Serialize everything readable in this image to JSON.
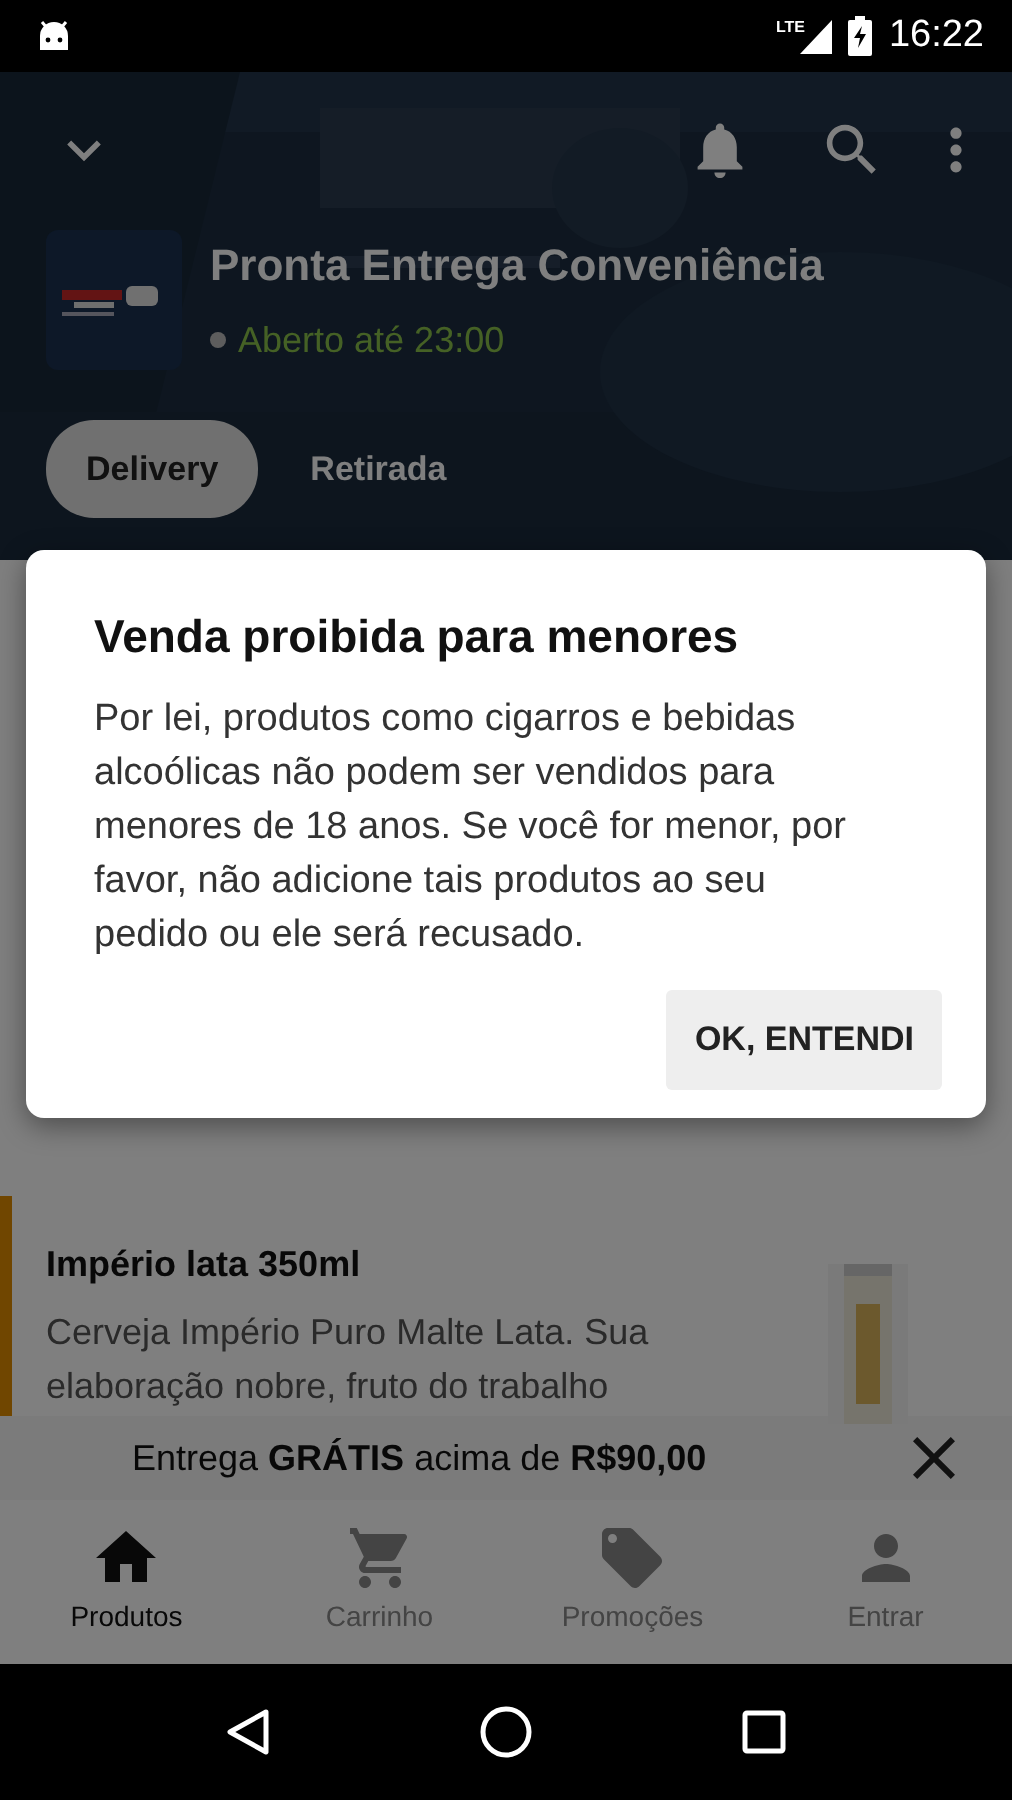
{
  "status_bar": {
    "network": "LTE",
    "time": "16:22"
  },
  "header": {
    "store_name": "Pronta Entrega Conveniência",
    "hours": "Aberto até 23:00"
  },
  "mode_tabs": [
    {
      "label": "Delivery",
      "selected": true
    },
    {
      "label": "Retirada",
      "selected": false
    }
  ],
  "product": {
    "name": "Império lata 350ml",
    "description": "Cerveja Império Puro Malte Lata. Sua elaboração nobre, fruto do trabalho"
  },
  "promo": {
    "message": "Entrega **GRÁTIS** acima de **R$90,00**"
  },
  "bottom_nav": [
    {
      "label": "Produtos",
      "kind": "home",
      "selected": true
    },
    {
      "label": "Carrinho",
      "kind": "cart",
      "selected": false
    },
    {
      "label": "Promoções",
      "kind": "tag",
      "selected": false
    },
    {
      "label": "Entrar",
      "kind": "person",
      "selected": false
    }
  ],
  "dialog": {
    "title": "Venda proibida para menores",
    "message": "Por lei, produtos como cigarros e bebidas alcoólicas não podem ser vendidos para menores de 18 anos. Se você for menor, por favor, não adicione tais produtos ao seu pedido ou ele será recusado.",
    "button": "OK, ENTENDI"
  }
}
